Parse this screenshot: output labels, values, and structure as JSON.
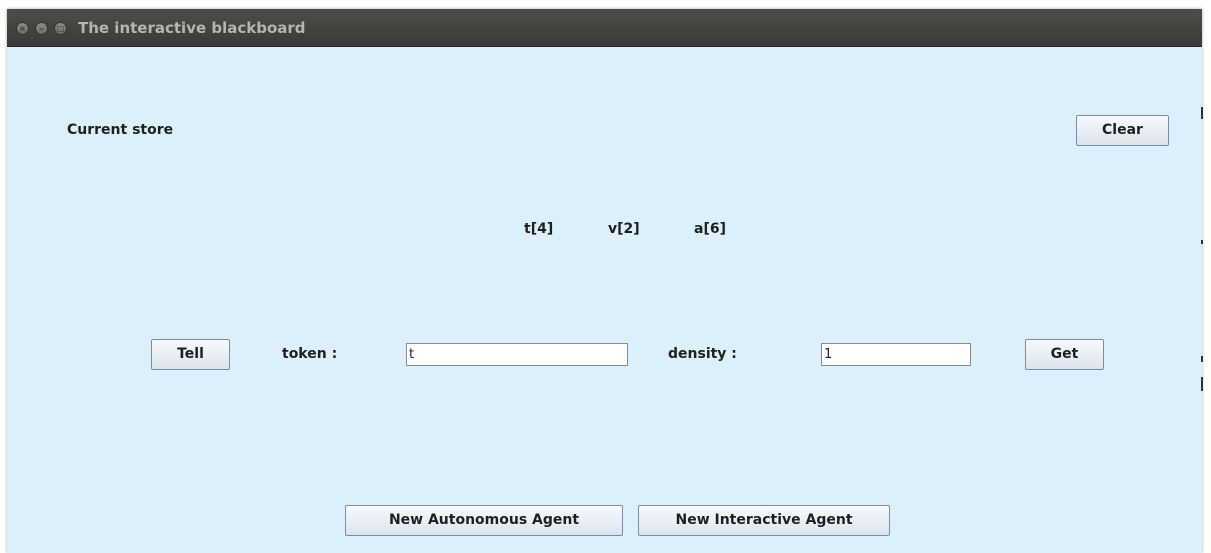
{
  "window": {
    "title": "The interactive blackboard"
  },
  "store": {
    "label": "Current store",
    "clear_label": "Clear",
    "items": [
      "t[4]",
      "v[2]",
      "a[6]"
    ]
  },
  "form": {
    "tell_label": "Tell",
    "token_label": "token :",
    "token_value": "t",
    "density_label": "density :",
    "density_value": "1",
    "get_label": "Get"
  },
  "agents": {
    "autonomous_label": "New Autonomous Agent",
    "interactive_label": "New Interactive Agent"
  }
}
